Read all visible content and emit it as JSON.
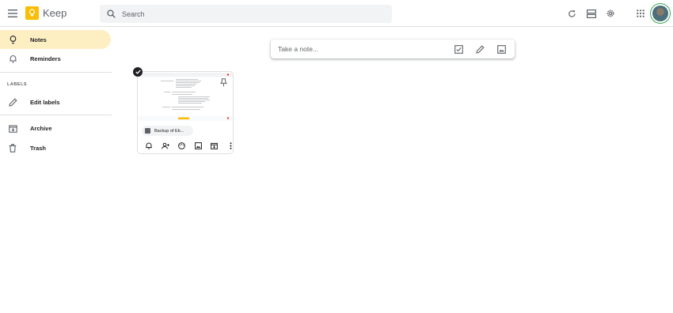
{
  "header": {
    "app_title": "Keep",
    "search_placeholder": "Search",
    "icons": [
      "menu-icon",
      "keep-logo-icon",
      "search-icon",
      "refresh-icon",
      "list-view-icon",
      "settings-icon",
      "apps-icon",
      "avatar"
    ]
  },
  "sidebar": {
    "items": [
      {
        "label": "Notes",
        "icon": "lightbulb-icon",
        "active": true
      },
      {
        "label": "Reminders",
        "icon": "bell-icon",
        "active": false
      },
      {
        "label": "Edit labels",
        "icon": "pencil-icon",
        "active": false
      },
      {
        "label": "Archive",
        "icon": "archive-icon",
        "active": false
      },
      {
        "label": "Trash",
        "icon": "trash-icon",
        "active": false
      }
    ],
    "section_label": "LABELS"
  },
  "take_note": {
    "placeholder": "Take a note...",
    "actions": [
      "new-list-icon",
      "new-drawing-icon",
      "new-image-icon"
    ]
  },
  "note": {
    "attachment_label": "Backup of Eb...",
    "selected": true,
    "actions": [
      "remind-me-icon",
      "collaborator-icon",
      "palette-icon",
      "add-image-icon",
      "archive-icon",
      "more-icon"
    ]
  },
  "colors": {
    "accent": "#fbbc04",
    "active_bg": "#feefc3",
    "text": "#202124",
    "muted": "#5f6368"
  }
}
